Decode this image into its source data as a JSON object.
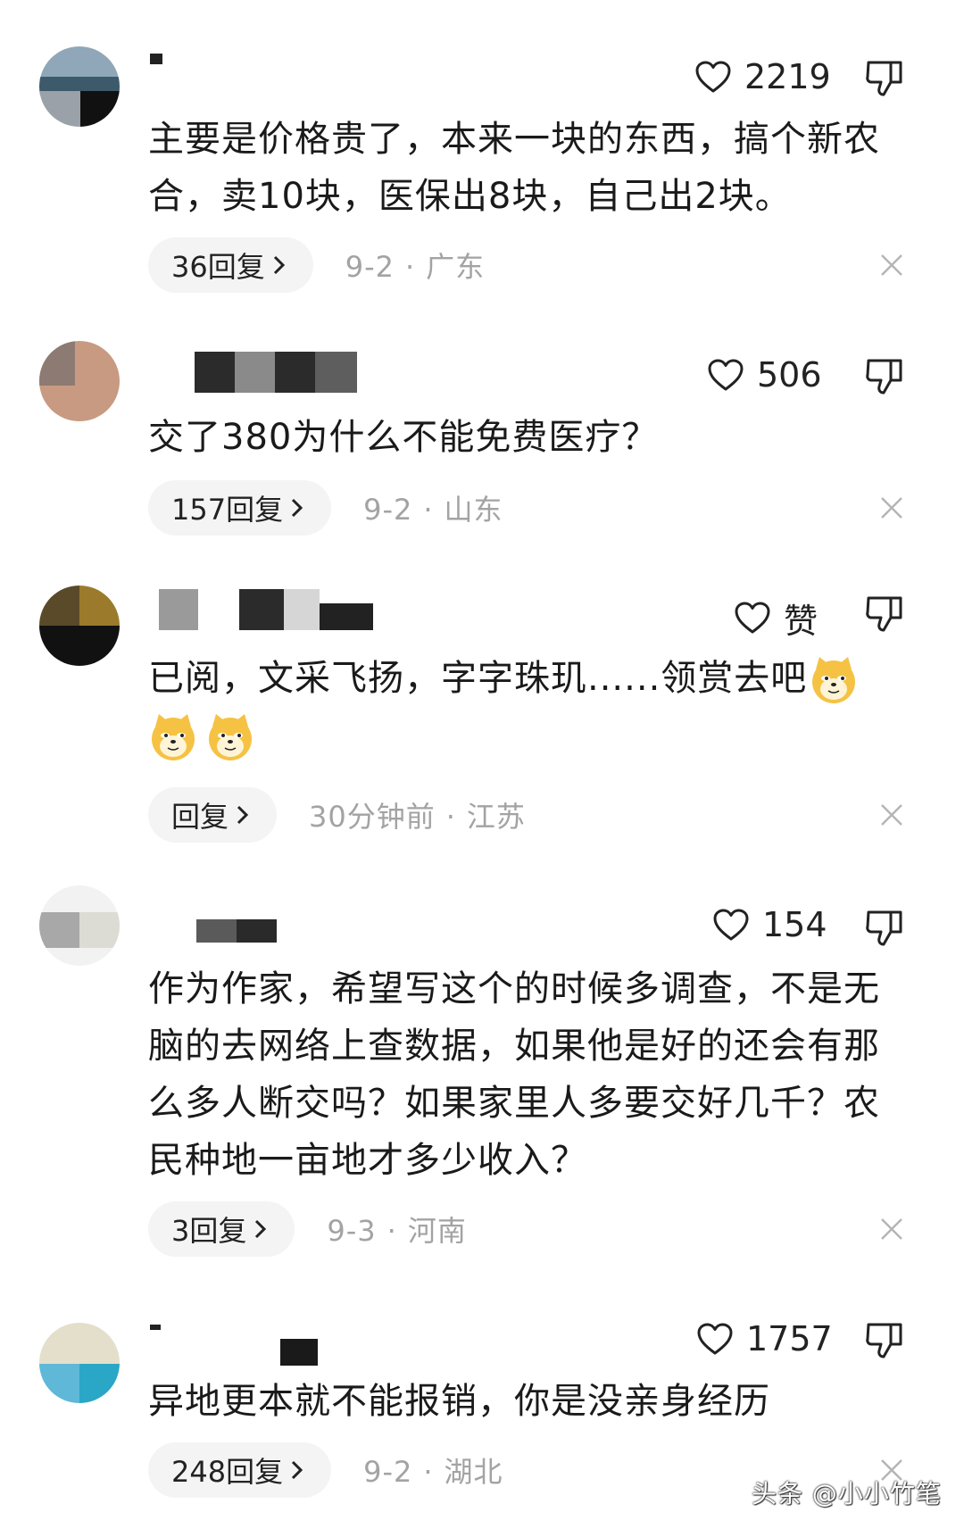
{
  "comments": [
    {
      "likes": "2219",
      "text_lines": [
        "主要是价格贵了，本来一块的东西，搞个新农",
        "合，卖10块，医保出8块，自己出2块。"
      ],
      "reply": "36回复",
      "date": "9-2",
      "location": "广东"
    },
    {
      "likes": "506",
      "text_lines": [
        "交了380为什么不能免费医疗？"
      ],
      "reply": "157回复",
      "date": "9-2",
      "location": "山东"
    },
    {
      "likes": "赞",
      "text_lines": [
        "已阅，文采飞扬，字字珠玑......领赏去吧"
      ],
      "reply": "回复",
      "date": "30分钟前",
      "location": "江苏"
    },
    {
      "likes": "154",
      "text_lines": [
        "作为作家，希望写这个的时候多调查，不是无",
        "脑的去网络上查数据，如果他是好的还会有那",
        "么多人断交吗？如果家里人多要交好几千？农",
        "民种地一亩地才多少收入？"
      ],
      "reply": "3回复",
      "date": "9-3",
      "location": "河南"
    },
    {
      "likes": "1757",
      "text_lines": [
        "异地更本就不能报销，你是没亲身经历"
      ],
      "reply": "248回复",
      "date": "9-2",
      "location": "湖北"
    }
  ],
  "watermark": "头条 @小小竹笔",
  "colors": {
    "text": "#1a1a1a",
    "meta": "#a3a3a3",
    "pill": "#f4f4f4"
  }
}
